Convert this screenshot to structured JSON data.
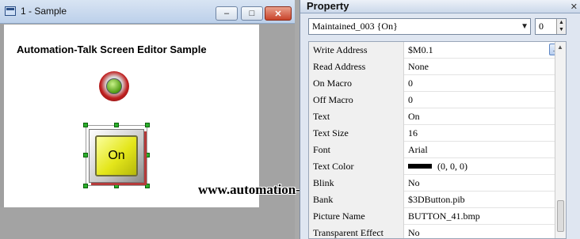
{
  "doc_window": {
    "title": "1 - Sample",
    "screen_title": "Automation-Talk Screen Editor Sample",
    "button_text": "On",
    "window_controls": {
      "minimize": "–",
      "maximize": "□",
      "close": "✕"
    }
  },
  "watermark": "www.automation-talk.info",
  "property_panel": {
    "title": "Property",
    "pin_icon": "✕",
    "object_selector": "Maintained_003 {On}",
    "number_value": "0",
    "rows": [
      {
        "name": "Write Address",
        "value": "$M0.1"
      },
      {
        "name": "Read Address",
        "value": "None"
      },
      {
        "name": "On Macro",
        "value": "0"
      },
      {
        "name": "Off Macro",
        "value": "0"
      },
      {
        "name": "Text",
        "value": "On"
      },
      {
        "name": "Text Size",
        "value": "16"
      },
      {
        "name": "Font",
        "value": "Arial"
      },
      {
        "name": "Text Color",
        "value": "(0, 0, 0)"
      },
      {
        "name": "Blink",
        "value": "No"
      },
      {
        "name": "Bank",
        "value": "$3DButton.pib"
      },
      {
        "name": "Picture Name",
        "value": "BUTTON_41.bmp"
      },
      {
        "name": "Transparent Effect",
        "value": "No"
      }
    ],
    "ellipsis_label": "...",
    "text_color_hex": "#000000"
  }
}
